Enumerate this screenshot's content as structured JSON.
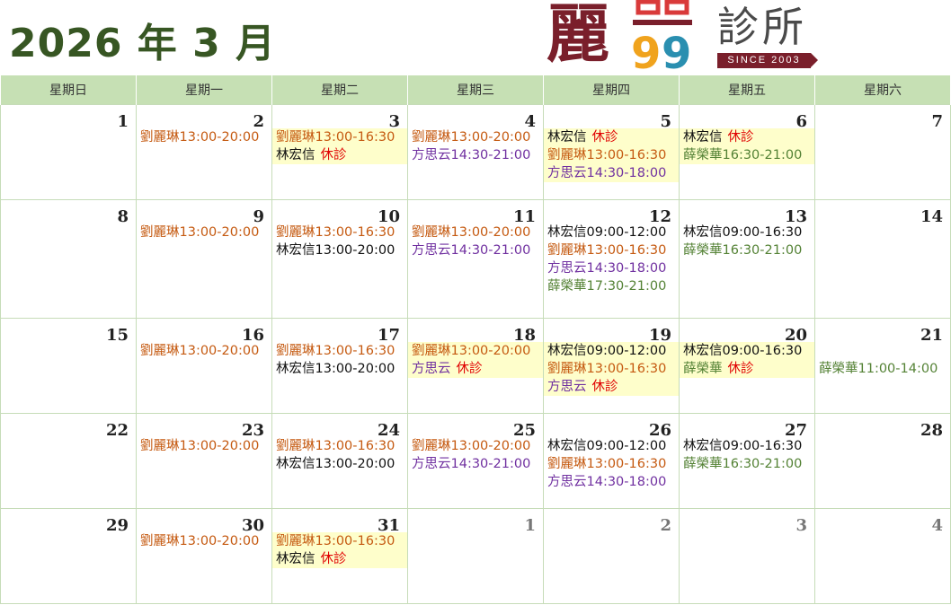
{
  "header": {
    "title": "2026 年 3 月"
  },
  "logo": {
    "char": "麗",
    "mark": "99",
    "clinic": "診所",
    "since": "SINCE 2003",
    "colors": {
      "maroon": "#7a1f2b",
      "orange": "#f0a31d",
      "teal": "#2a8fb0",
      "green": "#6aaa2f",
      "red": "#d93a3a"
    }
  },
  "colors": {
    "header_bg": "#c6e0b4",
    "highlight_bg": "#fefecb",
    "off_red": "#e00000",
    "liu": "#c55a11",
    "lin": "#111111",
    "fang": "#7030a0",
    "xue": "#548235",
    "title": "#375623"
  },
  "weekdays": [
    "星期日",
    "星期一",
    "星期二",
    "星期三",
    "星期四",
    "星期五",
    "星期六"
  ],
  "off_label": "休診",
  "weeks": [
    {
      "height": 106,
      "days": [
        {
          "day": "1",
          "entries": []
        },
        {
          "day": "2",
          "entries": [
            {
              "doc": "liu",
              "text": "劉麗琳13:00-20:00"
            }
          ]
        },
        {
          "day": "3",
          "highlight": true,
          "entries": [
            {
              "doc": "liu",
              "text": "劉麗琳13:00-16:30"
            },
            {
              "doc": "lin",
              "text": "林宏信",
              "off": true
            }
          ]
        },
        {
          "day": "4",
          "entries": [
            {
              "doc": "liu",
              "text": "劉麗琳13:00-20:00"
            },
            {
              "doc": "fang",
              "text": "方思云14:30-21:00"
            }
          ]
        },
        {
          "day": "5",
          "highlight": true,
          "entries": [
            {
              "doc": "lin",
              "text": "林宏信",
              "off": true
            },
            {
              "doc": "liu",
              "text": "劉麗琳13:00-16:30"
            },
            {
              "doc": "fang",
              "text": "方思云14:30-18:00"
            }
          ]
        },
        {
          "day": "6",
          "highlight": true,
          "entries": [
            {
              "doc": "lin",
              "text": "林宏信",
              "off": true
            },
            {
              "doc": "xue",
              "text": "薛榮華16:30-21:00"
            }
          ]
        },
        {
          "day": "7",
          "entries": []
        }
      ]
    },
    {
      "height": 132,
      "days": [
        {
          "day": "8",
          "entries": []
        },
        {
          "day": "9",
          "entries": [
            {
              "doc": "liu",
              "text": "劉麗琳13:00-20:00"
            }
          ]
        },
        {
          "day": "10",
          "entries": [
            {
              "doc": "liu",
              "text": "劉麗琳13:00-16:30"
            },
            {
              "doc": "lin",
              "text": "林宏信13:00-20:00"
            }
          ]
        },
        {
          "day": "11",
          "entries": [
            {
              "doc": "liu",
              "text": "劉麗琳13:00-20:00"
            },
            {
              "doc": "fang",
              "text": "方思云14:30-21:00"
            }
          ]
        },
        {
          "day": "12",
          "entries": [
            {
              "doc": "lin",
              "text": "林宏信09:00-12:00"
            },
            {
              "doc": "liu",
              "text": "劉麗琳13:00-16:30"
            },
            {
              "doc": "fang",
              "text": "方思云14:30-18:00"
            },
            {
              "doc": "xue",
              "text": "薛榮華17:30-21:00"
            }
          ]
        },
        {
          "day": "13",
          "entries": [
            {
              "doc": "lin",
              "text": "林宏信09:00-16:30"
            },
            {
              "doc": "xue",
              "text": "薛榮華16:30-21:00"
            }
          ]
        },
        {
          "day": "14",
          "entries": []
        }
      ]
    },
    {
      "height": 106,
      "days": [
        {
          "day": "15",
          "entries": []
        },
        {
          "day": "16",
          "entries": [
            {
              "doc": "liu",
              "text": "劉麗琳13:00-20:00"
            }
          ]
        },
        {
          "day": "17",
          "entries": [
            {
              "doc": "liu",
              "text": "劉麗琳13:00-16:30"
            },
            {
              "doc": "lin",
              "text": "林宏信13:00-20:00"
            }
          ]
        },
        {
          "day": "18",
          "highlight": true,
          "entries": [
            {
              "doc": "liu",
              "text": "劉麗琳13:00-20:00"
            },
            {
              "doc": "fang",
              "text": "方思云",
              "off": true
            }
          ]
        },
        {
          "day": "19",
          "highlight": true,
          "entries": [
            {
              "doc": "lin",
              "text": "林宏信09:00-12:00"
            },
            {
              "doc": "liu",
              "text": "劉麗琳13:00-16:30"
            },
            {
              "doc": "fang",
              "text": "方思云",
              "off": true
            }
          ]
        },
        {
          "day": "20",
          "highlight": true,
          "entries": [
            {
              "doc": "lin",
              "text": "林宏信09:00-16:30"
            },
            {
              "doc": "xue",
              "text": "薛榮華",
              "off": true
            }
          ]
        },
        {
          "day": "21",
          "entries": [
            {
              "doc": "none",
              "text": ""
            },
            {
              "doc": "xue",
              "text": "薛榮華11:00-14:00"
            }
          ]
        }
      ]
    },
    {
      "height": 106,
      "days": [
        {
          "day": "22",
          "entries": []
        },
        {
          "day": "23",
          "entries": [
            {
              "doc": "liu",
              "text": "劉麗琳13:00-20:00"
            }
          ]
        },
        {
          "day": "24",
          "entries": [
            {
              "doc": "liu",
              "text": "劉麗琳13:00-16:30"
            },
            {
              "doc": "lin",
              "text": "林宏信13:00-20:00"
            }
          ]
        },
        {
          "day": "25",
          "entries": [
            {
              "doc": "liu",
              "text": "劉麗琳13:00-20:00"
            },
            {
              "doc": "fang",
              "text": "方思云14:30-21:00"
            }
          ]
        },
        {
          "day": "26",
          "entries": [
            {
              "doc": "lin",
              "text": "林宏信09:00-12:00"
            },
            {
              "doc": "liu",
              "text": "劉麗琳13:00-16:30"
            },
            {
              "doc": "fang",
              "text": "方思云14:30-18:00"
            }
          ]
        },
        {
          "day": "27",
          "entries": [
            {
              "doc": "lin",
              "text": "林宏信09:00-16:30"
            },
            {
              "doc": "xue",
              "text": "薛榮華16:30-21:00"
            }
          ]
        },
        {
          "day": "28",
          "entries": []
        }
      ]
    },
    {
      "height": 106,
      "days": [
        {
          "day": "29",
          "entries": []
        },
        {
          "day": "30",
          "entries": [
            {
              "doc": "liu",
              "text": "劉麗琳13:00-20:00"
            }
          ]
        },
        {
          "day": "31",
          "highlight": true,
          "entries": [
            {
              "doc": "liu",
              "text": "劉麗琳13:00-16:30"
            },
            {
              "doc": "lin",
              "text": "林宏信",
              "off": true
            }
          ]
        },
        {
          "day": "1",
          "other": true,
          "entries": []
        },
        {
          "day": "2",
          "other": true,
          "entries": []
        },
        {
          "day": "3",
          "other": true,
          "entries": []
        },
        {
          "day": "4",
          "other": true,
          "entries": []
        }
      ]
    }
  ]
}
